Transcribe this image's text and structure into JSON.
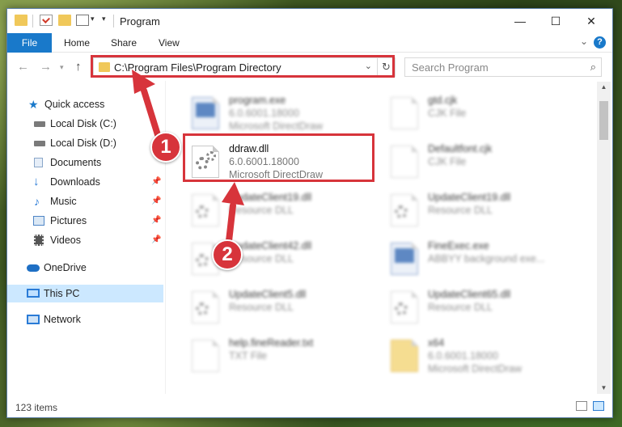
{
  "window": {
    "title": "Program",
    "ribbon_tabs": {
      "file": "File",
      "home": "Home",
      "share": "Share",
      "view": "View"
    },
    "help": "?"
  },
  "address": {
    "path": "C:\\Program Files\\Program Directory",
    "search_placeholder": "Search Program"
  },
  "sidebar": {
    "items": [
      {
        "label": "Quick access",
        "icon": "star-icon",
        "color": "#1979ca"
      },
      {
        "label": "Local Disk (C:)",
        "icon": "drive-icon",
        "color": "#7a7a7a"
      },
      {
        "label": "Local Disk (D:)",
        "icon": "drive-icon",
        "color": "#7a7a7a"
      },
      {
        "label": "Documents",
        "icon": "documents-icon",
        "color": "#8aa7c9"
      },
      {
        "label": "Downloads",
        "icon": "download-icon",
        "color": "#2a7bd6"
      },
      {
        "label": "Music",
        "icon": "music-icon",
        "color": "#2a7bd6"
      },
      {
        "label": "Pictures",
        "icon": "pictures-icon",
        "color": "#4f86c6"
      },
      {
        "label": "Videos",
        "icon": "videos-icon",
        "color": "#555555"
      },
      {
        "label": "OneDrive",
        "icon": "cloud-icon",
        "color": "#1e6fc4"
      },
      {
        "label": "This PC",
        "icon": "computer-icon",
        "color": "#2a7bd6"
      },
      {
        "label": "Network",
        "icon": "network-icon",
        "color": "#2a7bd6"
      }
    ]
  },
  "files": [
    {
      "name": "program.exe",
      "line1": "6.0.6001.18000",
      "line2": "Microsoft DirectDraw",
      "icon": "exe-icon"
    },
    {
      "name": "gtd.cjk",
      "line1": "CJK File",
      "line2": "",
      "icon": "file-icon"
    },
    {
      "name": "ddraw.dll",
      "line1": "6.0.6001.18000",
      "line2": "Microsoft DirectDraw",
      "icon": "dll-gear-icon"
    },
    {
      "name": "Defaultfont.cjk",
      "line1": "CJK File",
      "line2": "",
      "icon": "file-icon"
    },
    {
      "name": "UpdateClient19.dll",
      "line1": "Resource DLL",
      "line2": "",
      "icon": "dll-gear-icon"
    },
    {
      "name": "UpdateClient19.dll",
      "line1": "Resource DLL",
      "line2": "",
      "icon": "dll-gear-icon"
    },
    {
      "name": "UpdateClient42.dll",
      "line1": "Resource DLL",
      "line2": "",
      "icon": "dll-gear-icon"
    },
    {
      "name": "FineExec.exe",
      "line1": "ABBYY background exe...",
      "line2": "",
      "icon": "exe-icon"
    },
    {
      "name": "UpdateClient5.dll",
      "line1": "Resource DLL",
      "line2": "",
      "icon": "dll-gear-icon"
    },
    {
      "name": "UpdateClient65.dll",
      "line1": "Resource DLL",
      "line2": "",
      "icon": "dll-gear-icon"
    },
    {
      "name": "help.fineReader.txt",
      "line1": "TXT File",
      "line2": "",
      "icon": "file-icon"
    },
    {
      "name": "x64",
      "line1": "6.0.6001.18000",
      "line2": "Microsoft DirectDraw",
      "icon": "folder-icon"
    }
  ],
  "status": {
    "count": "123 items"
  },
  "annotations": {
    "step1": "1",
    "step2": "2",
    "color": "#d7343b"
  }
}
